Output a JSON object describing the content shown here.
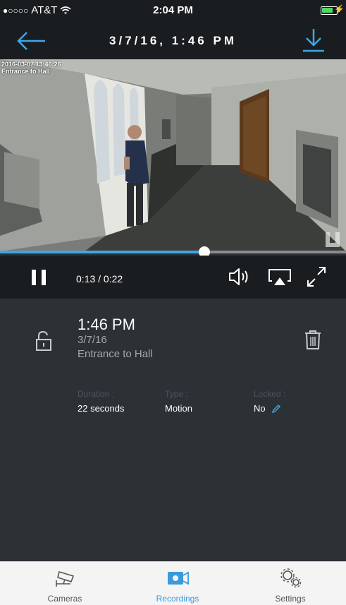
{
  "status_bar": {
    "carrier": "AT&T",
    "signal_dots": "●○○○○",
    "time": "2:04 PM"
  },
  "nav": {
    "title": "3/7/16, 1:46 PM"
  },
  "video": {
    "timestamp_line1": "2016-03-07 13:46:26",
    "timestamp_line2": "Entrance to Hall"
  },
  "player": {
    "progress": 0.59,
    "timecode": "0:13 / 0:22"
  },
  "recording": {
    "time": "1:46 PM",
    "date": "3/7/16",
    "camera": "Entrance to Hall",
    "duration_label": "Duration :",
    "duration_value": "22 seconds",
    "type_label": "Type :",
    "type_value": "Motion",
    "locked_label": "Locked :",
    "locked_value": "No"
  },
  "tabs": [
    {
      "label": "Cameras",
      "icon": "camera-cctv-icon",
      "active": false
    },
    {
      "label": "Recordings",
      "icon": "recordings-icon",
      "active": true
    },
    {
      "label": "Settings",
      "icon": "gears-icon",
      "active": false
    }
  ],
  "colors": {
    "accent": "#3da6e6",
    "bar": "#1a1d20",
    "panel": "#2c3136",
    "label": "#4d5359",
    "subtext": "#a3a8ad"
  }
}
